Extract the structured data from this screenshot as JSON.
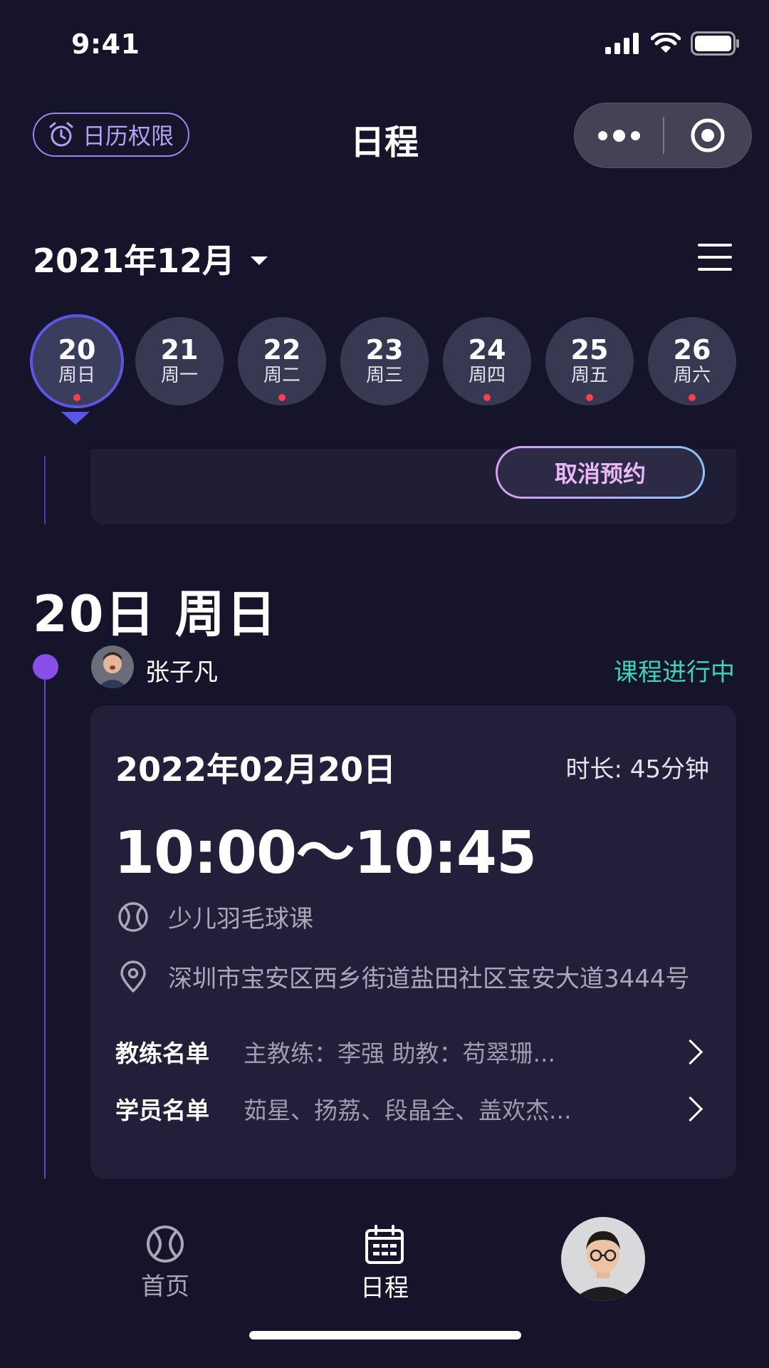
{
  "status_bar": {
    "time": "9:41"
  },
  "header": {
    "permission_label": "日历权限",
    "title": "日程"
  },
  "calendar": {
    "month_label": "2021年12月",
    "days": [
      {
        "num": "20",
        "weekday": "周日",
        "selected": true,
        "has_event": true
      },
      {
        "num": "21",
        "weekday": "周一",
        "selected": false,
        "has_event": false
      },
      {
        "num": "22",
        "weekday": "周二",
        "selected": false,
        "has_event": true
      },
      {
        "num": "23",
        "weekday": "周三",
        "selected": false,
        "has_event": false
      },
      {
        "num": "24",
        "weekday": "周四",
        "selected": false,
        "has_event": true
      },
      {
        "num": "25",
        "weekday": "周五",
        "selected": false,
        "has_event": true
      },
      {
        "num": "26",
        "weekday": "周六",
        "selected": false,
        "has_event": true
      }
    ]
  },
  "previous_card": {
    "cancel_label": "取消预约"
  },
  "date_heading": "20日 周日",
  "entry": {
    "student_name": "张子凡",
    "status": "课程进行中",
    "status_color": "#3fd3b6",
    "date": "2022年02月20日",
    "duration": "时长: 45分钟",
    "time_range": "10:00～10:45",
    "course": "少儿羽毛球课",
    "address": "深圳市宝安区西乡街道盐田社区宝安大道3444号",
    "coach_label": "教练名单",
    "coach_value": "主教练：李强      助教：苟翠珊...",
    "student_label": "学员名单",
    "student_value": "茹星、扬荔、段晶全、盖欢杰..."
  },
  "tabbar": {
    "home_label": "首页",
    "schedule_label": "日程"
  },
  "colors": {
    "accent": "#5c56e8",
    "dot": "#ff3d4d",
    "timeline_dot": "#8a4ee8"
  }
}
